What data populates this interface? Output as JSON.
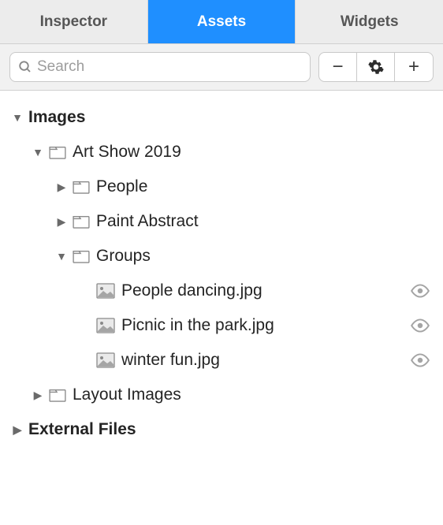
{
  "tabs": {
    "inspector": "Inspector",
    "assets": "Assets",
    "widgets": "Widgets"
  },
  "search": {
    "placeholder": "Search"
  },
  "tree": {
    "images": "Images",
    "art_show": "Art Show 2019",
    "people": "People",
    "paint_abstract": "Paint Abstract",
    "groups": "Groups",
    "file_dancing": "People dancing.jpg",
    "file_picnic": "Picnic in the park.jpg",
    "file_winter": "winter fun.jpg",
    "layout_images": "Layout Images",
    "external_files": "External Files"
  }
}
